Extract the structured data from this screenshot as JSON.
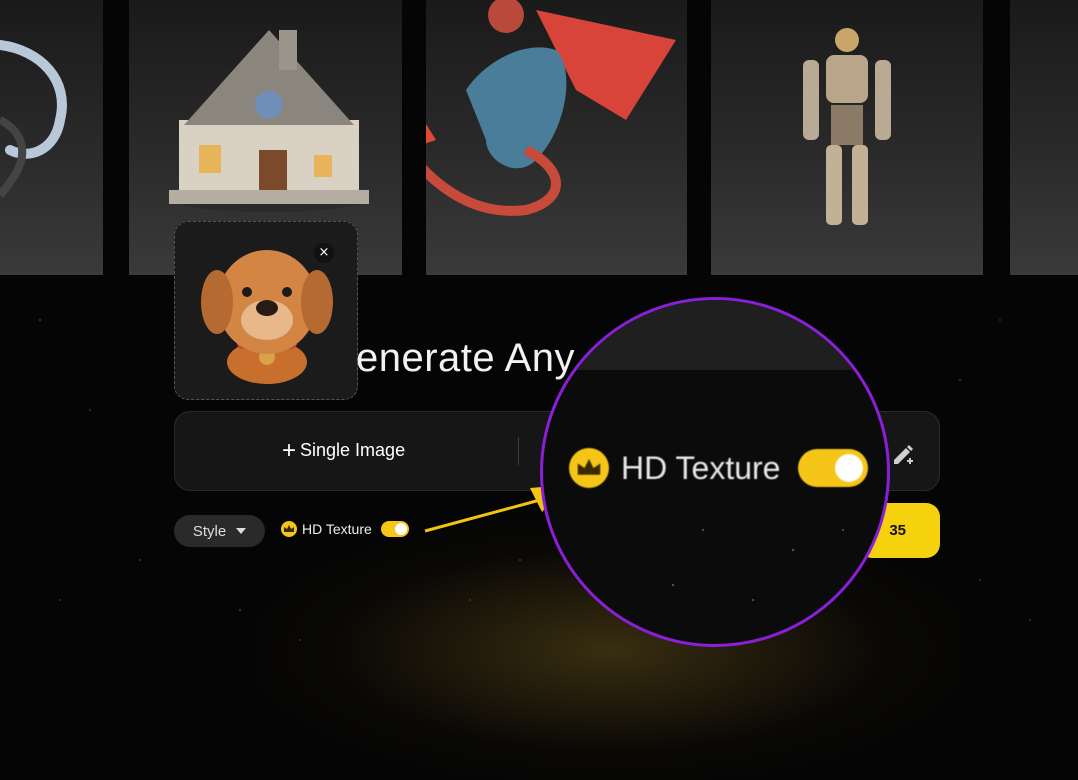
{
  "hero": {
    "title": "enerate Any"
  },
  "upload": {
    "close_label": "×"
  },
  "modes": {
    "single_image_label": "Single Image"
  },
  "options": {
    "style_label": "Style",
    "hd_texture_label": "HD Texture",
    "hd_texture_enabled": true
  },
  "generate": {
    "cost": "35"
  },
  "zoom": {
    "hd_texture_label": "HD Texture"
  },
  "colors": {
    "accent": "#f5c518",
    "highlight_ring": "#8b1fd8",
    "generate_button": "#f5d20d"
  },
  "icons": [
    "close-icon",
    "plus-icon",
    "pencil-icon",
    "caret-down-icon",
    "crown-icon",
    "arrow-icon"
  ]
}
